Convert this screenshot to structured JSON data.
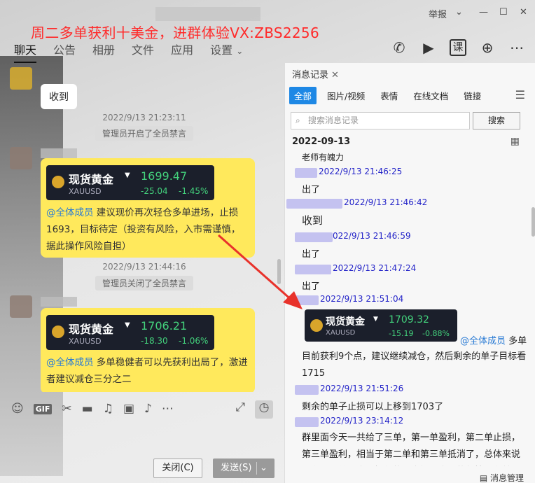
{
  "window": {
    "report": "举报",
    "controls": [
      "⌄",
      "—",
      "☐",
      "✕"
    ]
  },
  "promo_text": "周二多单获利十美金，进群体验VX:ZBS2256",
  "tabs": [
    "聊天",
    "公告",
    "相册",
    "文件",
    "应用",
    "设置"
  ],
  "head_icons": [
    "phone-icon",
    "video-icon",
    "class-icon",
    "add-icon",
    "more-icon"
  ],
  "chat": {
    "msg_received": "收到",
    "ts1": "2022/9/13 21:23:11",
    "sys1": "管理员开启了全员禁言",
    "card1": {
      "name": "现货黄金",
      "symbol": "XAUUSD",
      "price": "1699.47",
      "change": "-25.04",
      "change_pct": "-1.45%",
      "at": "@全体成员",
      "text": " 建议现价再次轻仓多单进场，止损1693，目标待定（投资有风险，入市需谨慎，据此操作风险自担）"
    },
    "ts2": "2022/9/13 21:44:16",
    "sys2": "管理员关闭了全员禁言",
    "card2": {
      "name": "现货黄金",
      "symbol": "XAUUSD",
      "price": "1706.21",
      "change": "-18.30",
      "change_pct": "-1.06%",
      "at": "@全体成员",
      "text": " 多单稳健者可以先获利出局了，激进者建议减仓三分之二"
    }
  },
  "toolbar": {
    "close": "关闭(C)",
    "send": "发送(S)"
  },
  "history": {
    "tab": "消息记录",
    "filters": [
      "全部",
      "图片/视频",
      "表情",
      "在线文档",
      "链接"
    ],
    "search_placeholder": "搜索消息记录",
    "search_btn": "搜索",
    "date": "2022-09-13",
    "top_line": "老师有魄力",
    "entries": [
      {
        "time": "2022/9/13 21:46:25",
        "msg": "出了"
      },
      {
        "time": "2022/9/13 21:46:42",
        "msg": "收到"
      },
      {
        "time": "022/9/13 21:46:59",
        "msg": "出了"
      },
      {
        "time": "2022/9/13 21:47:24",
        "msg": "出了"
      },
      {
        "time": "2022/9/13 21:51:04"
      },
      {
        "time": "2022/9/13 21:51:26",
        "msg": "剩余的单子止损可以上移到1703了"
      },
      {
        "time": "2022/9/13 23:14:12"
      }
    ],
    "card": {
      "name": "现货黄金",
      "symbol": "XAUUSD",
      "price": "1709.32",
      "change": "-15.19",
      "change_pct": "-0.88%",
      "at": "@全体成员",
      "text_after": " 多单",
      "text_lines": "目前获利9个点，建议继续减仓，然后剩余的单子目标看1715"
    },
    "last_para": "群里面今天一共给了三单，第一单盈利，第二单止损，第三单盈利，相当于第二单和第三单抵消了，总体来说盈利了一单，今天操作的不太好，今天的行情都在前面了",
    "manage": "消息管理"
  }
}
